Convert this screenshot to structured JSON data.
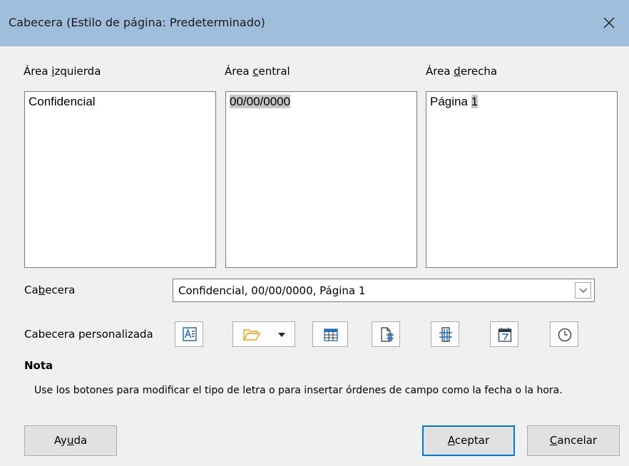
{
  "window": {
    "title": "Cabecera (Estilo de página: Predeterminado)",
    "close_icon": "close-icon"
  },
  "areas": {
    "left": {
      "label_pre": "Área ",
      "label_key": "i",
      "label_post": "zquierda",
      "content": "Confidencial"
    },
    "center": {
      "label_pre": "Área ",
      "label_key": "c",
      "label_post": "entral",
      "content_field": "00/00/0000"
    },
    "right": {
      "label_pre": "Área ",
      "label_key": "d",
      "label_post": "erecha",
      "content_text": "Página ",
      "content_field": "1"
    }
  },
  "header": {
    "label_pre": "Ca",
    "label_key": "b",
    "label_post": "ecera",
    "selected_value": "Confidencial, 00/00/0000, Página 1"
  },
  "custom_header": {
    "label": "Cabecera personalizada",
    "buttons": [
      {
        "icon": "text-attributes-icon"
      },
      {
        "icon": "folder-dropdown-icon"
      },
      {
        "icon": "table-icon"
      },
      {
        "icon": "page-number-icon"
      },
      {
        "icon": "page-count-icon"
      },
      {
        "icon": "calendar-date-icon"
      },
      {
        "icon": "clock-time-icon"
      }
    ]
  },
  "note": {
    "title": "Nota",
    "text": "Use los botones para modificar el tipo de letra o para insertar órdenes de campo como la fecha o la hora."
  },
  "buttons": {
    "help": {
      "pre": "Ay",
      "key": "u",
      "post": "da"
    },
    "ok": {
      "pre": "",
      "key": "A",
      "post": "ceptar"
    },
    "cancel": {
      "pre": "",
      "key": "C",
      "post": "ancelar"
    }
  },
  "colors": {
    "titlebar": "#9fbedb",
    "default_button_border": "#0078d7",
    "icon_blue": "#1e6fc1",
    "folder_orange": "#f3a21b"
  }
}
